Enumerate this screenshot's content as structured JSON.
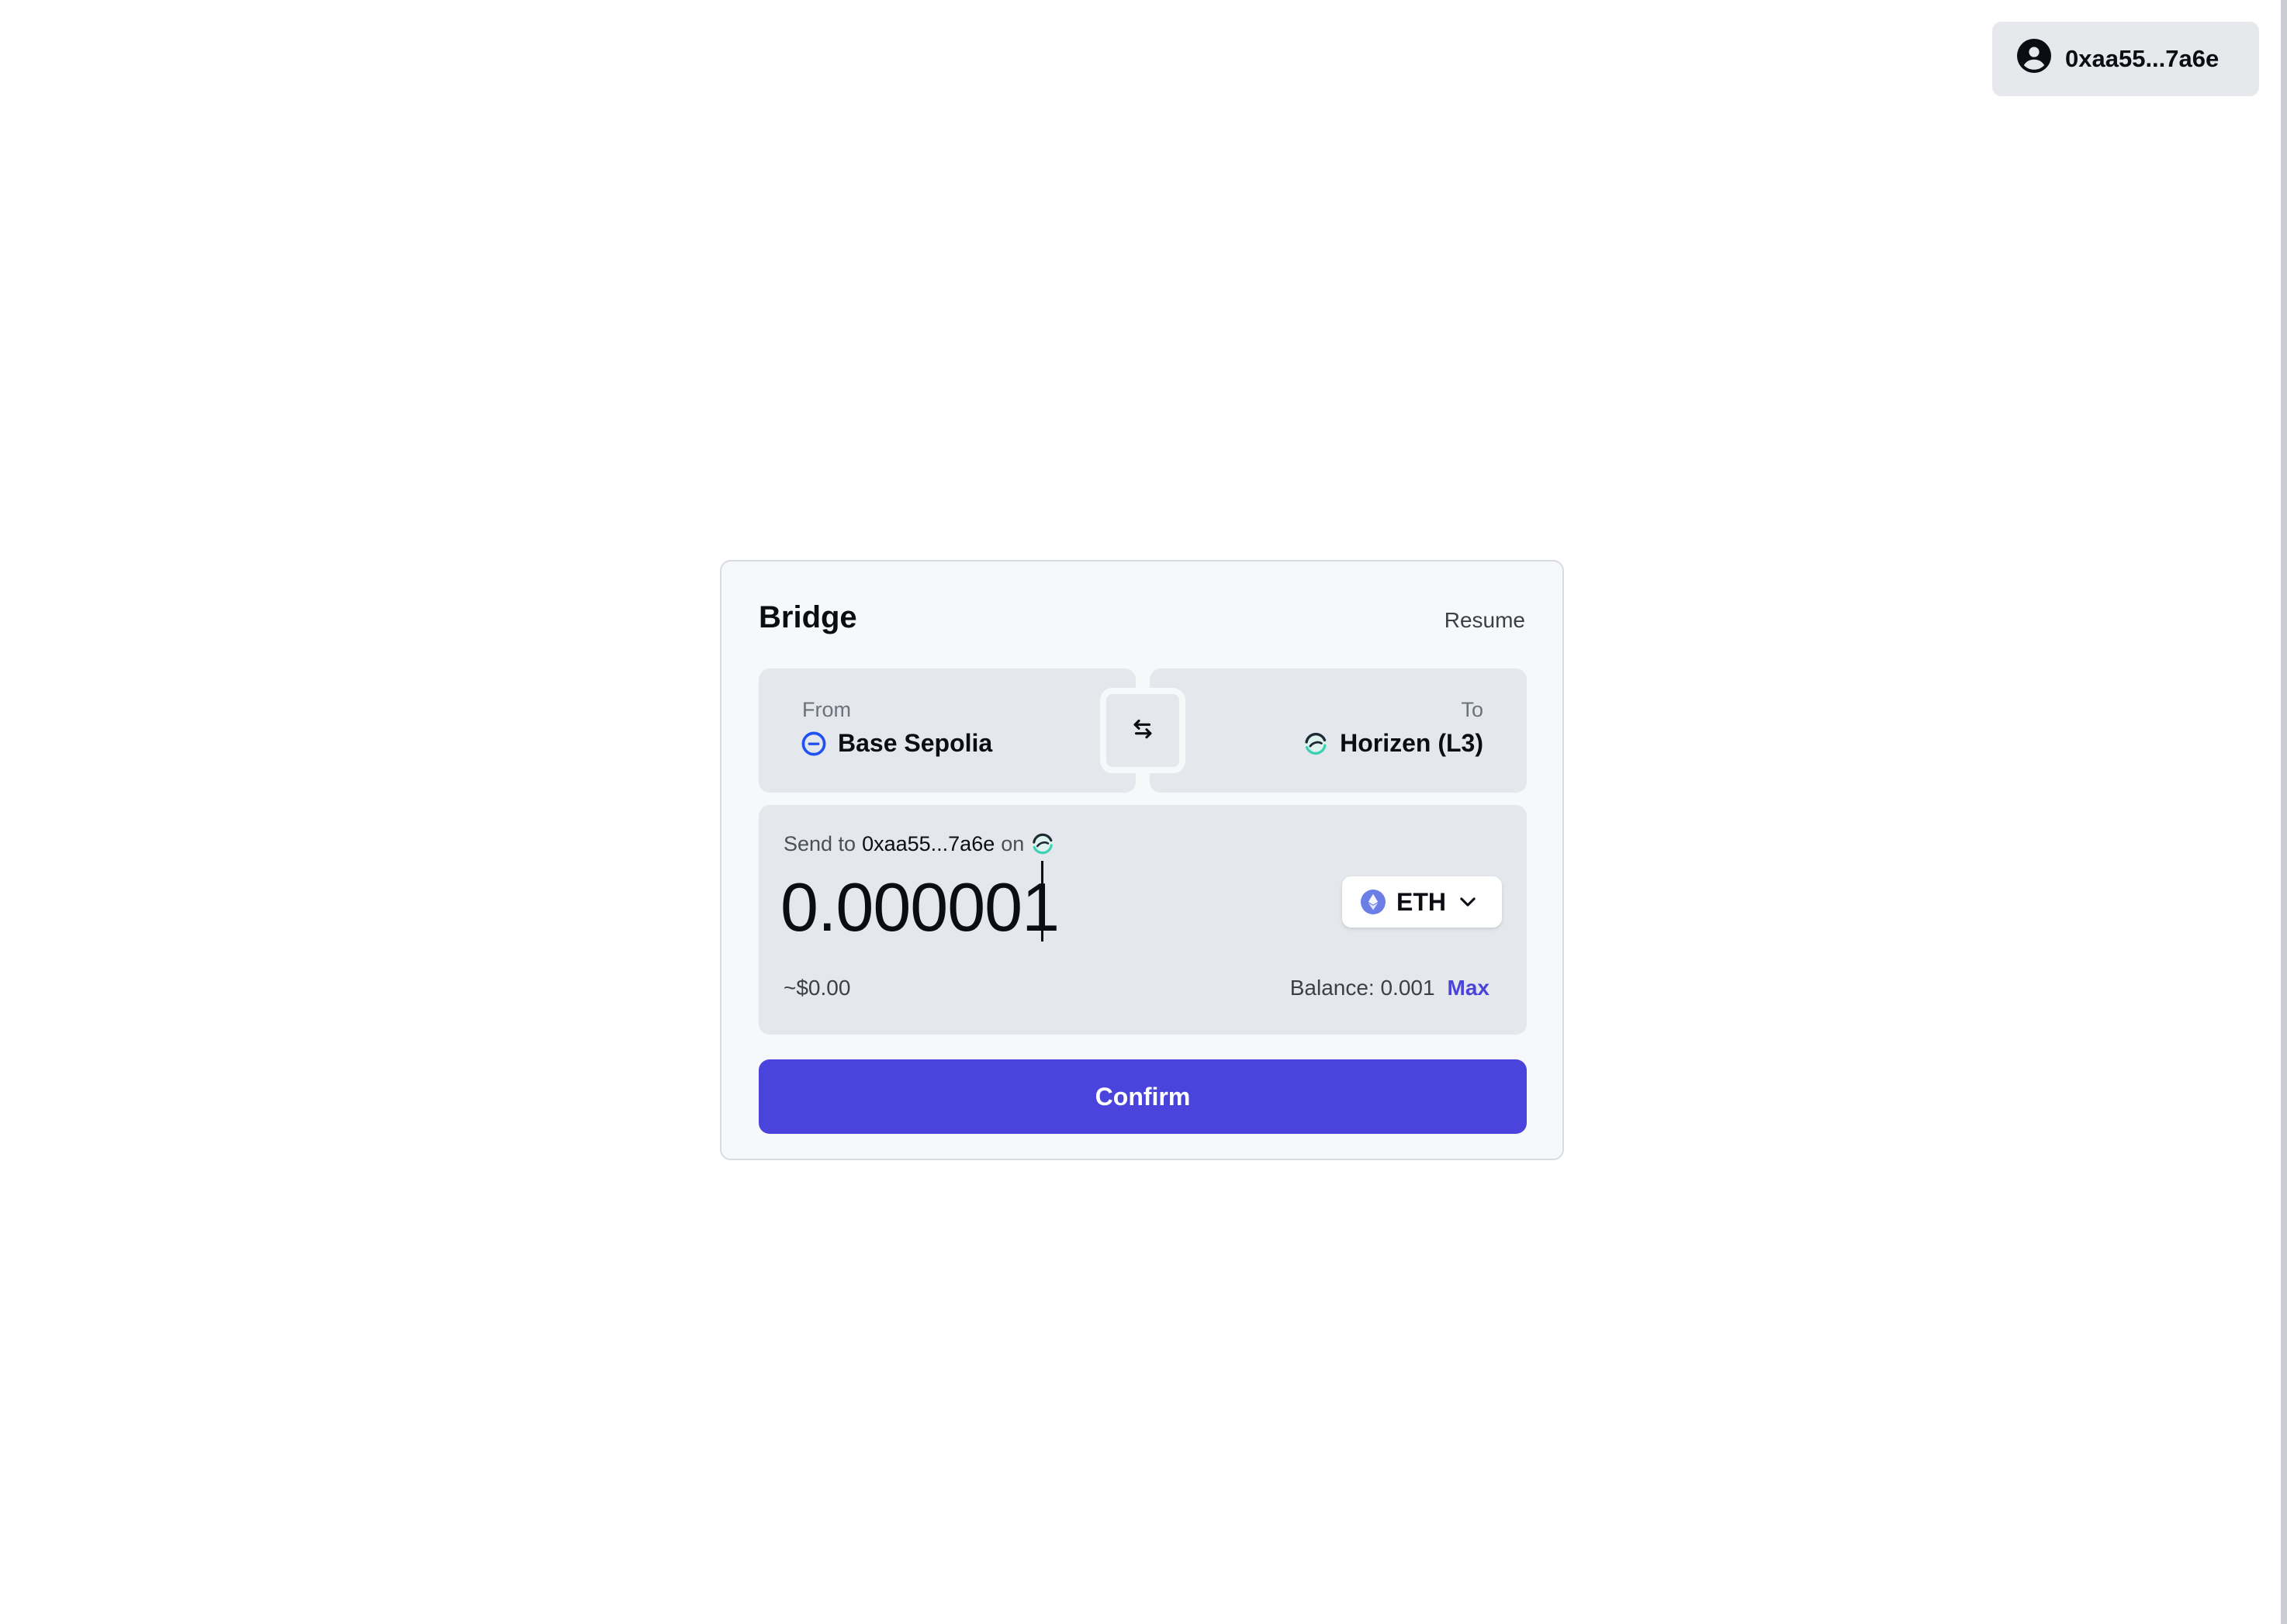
{
  "account": {
    "address": "0xaa55...7a6e",
    "icon": "user-circle-icon"
  },
  "bridge": {
    "title": "Bridge",
    "resume_label": "Resume",
    "from": {
      "label": "From",
      "chain": "Base Sepolia",
      "icon": "base-chain-icon"
    },
    "to": {
      "label": "To",
      "chain": "Horizen (L3)",
      "icon": "horizen-chain-icon"
    },
    "swap_icon": "swap-arrows-icon",
    "send_to": {
      "prefix": "Send to",
      "address": "0xaa55...7a6e",
      "suffix": "on"
    },
    "amount": {
      "value": "0.000001"
    },
    "token": {
      "symbol": "ETH",
      "icon": "eth-icon"
    },
    "usd_value": "~$0.00",
    "balance": {
      "label": "Balance: 0.001",
      "max_label": "Max"
    },
    "confirm_label": "Confirm"
  },
  "colors": {
    "accent": "#4b44dc",
    "panel": "#e4e7ec",
    "card": "#f7f8fa",
    "base_blue": "#2151f5",
    "horizen_teal": "#3fd0b4"
  }
}
